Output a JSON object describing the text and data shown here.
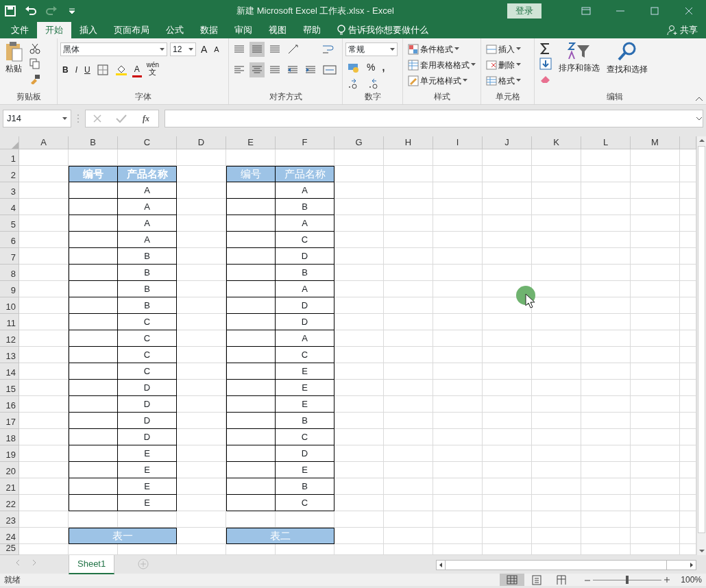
{
  "title_bar": {
    "title": "新建 Microsoft Excel 工作表.xlsx  -  Excel",
    "login_button": "登录"
  },
  "menu_tabs": [
    {
      "label": "文件",
      "selected": false
    },
    {
      "label": "开始",
      "selected": true
    },
    {
      "label": "插入",
      "selected": false
    },
    {
      "label": "页面布局",
      "selected": false
    },
    {
      "label": "公式",
      "selected": false
    },
    {
      "label": "数据",
      "selected": false
    },
    {
      "label": "审阅",
      "selected": false
    },
    {
      "label": "视图",
      "selected": false
    },
    {
      "label": "帮助",
      "selected": false
    }
  ],
  "tell_me": "告诉我你想要做什么",
  "share": "共享",
  "ribbon": {
    "clipboard": {
      "paste": "粘贴",
      "label": "剪贴板"
    },
    "font": {
      "font_name": "黑体",
      "font_size": "12",
      "grow": "A",
      "shrink": "A",
      "bold": "B",
      "italic": "I",
      "underline": "U",
      "font_color": "A",
      "phonetic": "wén",
      "phonetic_char": "文",
      "label": "字体"
    },
    "alignment": {
      "label": "对齐方式"
    },
    "number": {
      "format": "常规",
      "percent": "%",
      "comma": ",",
      "label": "数字"
    },
    "styles": {
      "items": [
        "条件格式",
        "套用表格格式",
        "单元格样式"
      ],
      "label": "样式"
    },
    "cells": {
      "items": [
        "插入",
        "删除",
        "格式"
      ],
      "label": "单元格"
    },
    "editing": {
      "sort": "排序和筛选",
      "find": "查找和选择",
      "label": "编辑"
    }
  },
  "formula_bar": {
    "name_box": "J14",
    "fx": "fx"
  },
  "columns": [
    "A",
    "B",
    "C",
    "D",
    "E",
    "F",
    "G",
    "H",
    "I",
    "J",
    "K",
    "L",
    "M"
  ],
  "rows": [
    "1",
    "2",
    "3",
    "4",
    "5",
    "6",
    "7",
    "8",
    "9",
    "10",
    "11",
    "12",
    "13",
    "14",
    "15",
    "16",
    "17",
    "18",
    "19",
    "20",
    "21",
    "22",
    "23",
    "24",
    "25"
  ],
  "tables": [
    {
      "headers": [
        "编号",
        "产品名称"
      ],
      "header_bold": true,
      "values": [
        "A",
        "A",
        "A",
        "A",
        "B",
        "B",
        "B",
        "B",
        "C",
        "C",
        "C",
        "C",
        "D",
        "D",
        "D",
        "D",
        "E",
        "E",
        "E",
        "E"
      ],
      "caption": "表一"
    },
    {
      "headers": [
        "编号",
        "产品名称"
      ],
      "header_bold": false,
      "values": [
        "A",
        "B",
        "A",
        "C",
        "D",
        "B",
        "A",
        "D",
        "D",
        "A",
        "C",
        "E",
        "E",
        "E",
        "B",
        "C",
        "D",
        "E",
        "B",
        "C"
      ],
      "caption": "表二"
    }
  ],
  "sheet_tabs": [
    {
      "label": "Sheet1",
      "selected": true
    }
  ],
  "status_bar": {
    "status": "就绪",
    "zoom": "100%",
    "zoom_slider": {
      "level": 0.5
    },
    "view_buttons": [
      {
        "kind": "normal",
        "selected": true
      },
      {
        "kind": "page_layout",
        "selected": false
      },
      {
        "kind": "page_break",
        "selected": false
      }
    ]
  }
}
